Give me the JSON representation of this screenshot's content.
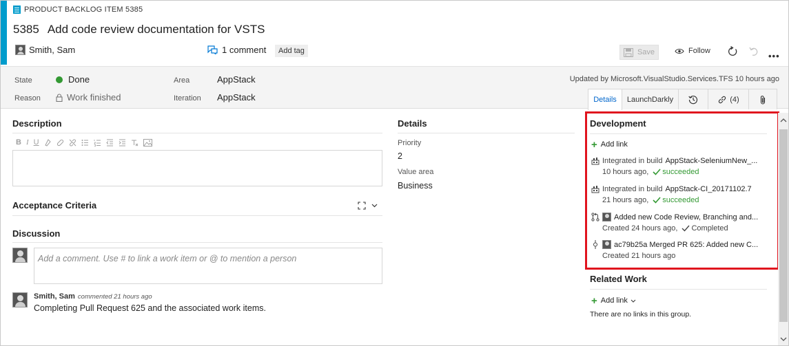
{
  "header": {
    "work_item_type": "PRODUCT BACKLOG ITEM 5385",
    "id": "5385",
    "title": "Add code review documentation for VSTS",
    "assigned_to": "Smith, Sam",
    "comments_label": "1 comment",
    "add_tag_label": "Add tag",
    "save_label": "Save",
    "follow_label": "Follow",
    "more_label": "•••"
  },
  "fields": {
    "state_label": "State",
    "state_value": "Done",
    "reason_label": "Reason",
    "reason_value": "Work finished",
    "area_label": "Area",
    "area_value": "AppStack",
    "iteration_label": "Iteration",
    "iteration_value": "AppStack",
    "updated_text": "Updated by Microsoft.VisualStudio.Services.TFS 10 hours ago",
    "state_color": "#339933"
  },
  "tabs": [
    {
      "label": "Details"
    },
    {
      "label": "LaunchDarkly"
    },
    {
      "label": ""
    },
    {
      "label": "(4)"
    },
    {
      "label": ""
    }
  ],
  "left": {
    "description_title": "Description",
    "acceptance_title": "Acceptance Criteria",
    "discussion_title": "Discussion",
    "comment_placeholder": "Add a comment. Use # to link a work item or @ to mention a person",
    "comment": {
      "author": "Smith, Sam",
      "meta": "commented 21 hours ago",
      "text": "Completing Pull Request 625 and the associated work items."
    }
  },
  "details": {
    "title": "Details",
    "priority_label": "Priority",
    "priority_value": "2",
    "value_area_label": "Value area",
    "value_area_value": "Business"
  },
  "development": {
    "title": "Development",
    "add_link": "Add link",
    "items": [
      {
        "icon": "build-icon",
        "prefix": "Integrated in build",
        "name": "AppStack-SeleniumNew_...",
        "time": "10 hours ago,",
        "status": "succeeded"
      },
      {
        "icon": "build-icon",
        "prefix": "Integrated in build",
        "name": "AppStack-CI_20171102.7",
        "time": "21 hours ago,",
        "status": "succeeded"
      },
      {
        "icon": "pull-request-icon",
        "prefix": "",
        "name": "Added new Code Review, Branching and...",
        "time": "Created 24 hours ago,",
        "status": "Completed"
      },
      {
        "icon": "commit-icon",
        "prefix": "",
        "name": "ac79b25a Merged PR 625: Added new C...",
        "time": "Created 21 hours ago",
        "status": ""
      }
    ]
  },
  "related": {
    "title": "Related Work",
    "add_link": "Add link",
    "empty_text": "There are no links in this group."
  },
  "colors": {
    "accent": "#009ccc",
    "highlight_border": "#e0141e",
    "success": "#339933"
  }
}
